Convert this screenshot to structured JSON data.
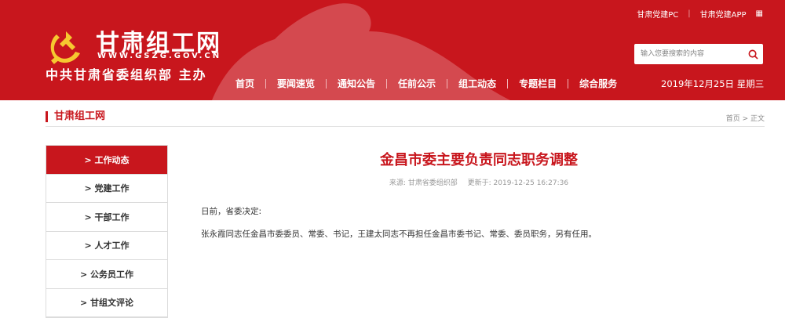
{
  "header": {
    "site_name": "甘肃组工网",
    "domain": "WWW.GSZG.GOV.CN",
    "org_name": "中共甘肃省委组织部  主办",
    "top_links": [
      "甘肃党建PC",
      "甘肃党建APP"
    ],
    "search_placeholder": "输入您要搜索的内容",
    "nav": [
      "首页",
      "要闻速览",
      "通知公告",
      "任前公示",
      "组工动态",
      "专题栏目",
      "综合服务"
    ],
    "date": "2019年12月25日 星期三",
    "brand_color": "#c8161d"
  },
  "section": {
    "title": "甘肃组工网",
    "breadcrumb": "首页 > 正文"
  },
  "sidebar": {
    "items": [
      {
        "label": "> 工作动态"
      },
      {
        "label": "> 党建工作"
      },
      {
        "label": "> 干部工作"
      },
      {
        "label": "> 人才工作"
      },
      {
        "label": "> 公务员工作"
      },
      {
        "label": "> 甘组文评论"
      }
    ]
  },
  "article": {
    "title": "金昌市委主要负责同志职务调整",
    "source": "来源: 甘肃省委组织部",
    "updated": "更新于: 2019-12-25 16:27:36",
    "paragraphs": [
      "日前，省委决定:",
      "张永霞同志任金昌市委委员、常委、书记，王建太同志不再担任金昌市委书记、常委、委员职务，另有任用。"
    ]
  }
}
